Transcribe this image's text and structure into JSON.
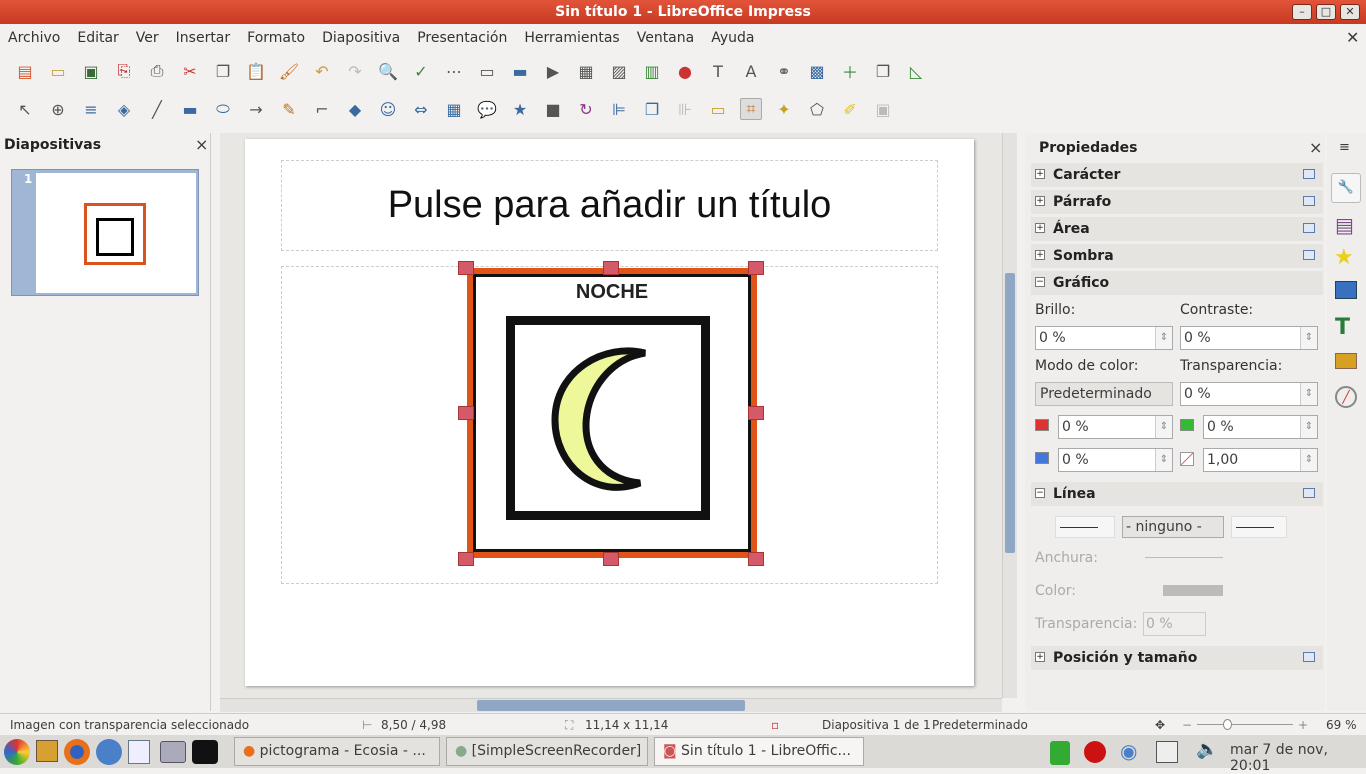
{
  "window": {
    "title": "Sin título 1 - LibreOffice Impress",
    "min": "–",
    "max": "□",
    "close": "✕"
  },
  "menu": [
    "Archivo",
    "Editar",
    "Ver",
    "Insertar",
    "Formato",
    "Diapositiva",
    "Presentación",
    "Herramientas",
    "Ventana",
    "Ayuda"
  ],
  "slides_pane": {
    "title": "Diapositivas",
    "close": "×",
    "slide_number": "1"
  },
  "slide": {
    "title_placeholder": "Pulse para añadir un título",
    "image_label": "NOCHE"
  },
  "sidebar": {
    "title": "Propiedades",
    "close": "×",
    "sections": {
      "caracter": "Carácter",
      "parrafo": "Párrafo",
      "area": "Área",
      "sombra": "Sombra",
      "grafico": "Gráfico",
      "linea": "Línea",
      "posicion": "Posición y tamaño"
    },
    "grafico": {
      "brillo_label": "Brillo:",
      "brillo": "0 %",
      "contraste_label": "Contraste:",
      "contraste": "0 %",
      "modo_label": "Modo de color:",
      "modo": "Predeterminado",
      "transp_label": "Transparencia:",
      "transp": "0 %",
      "red": "0 %",
      "green": "0 %",
      "blue": "0 %",
      "gamma": "1,00"
    },
    "linea": {
      "style": "- ninguno -",
      "anchura_label": "Anchura:",
      "color_label": "Color:",
      "transp_label": "Transparencia:",
      "transp": "0 %"
    }
  },
  "status": {
    "message": "Imagen con transparencia seleccionado",
    "position": "8,50 / 4,98",
    "size": "11,14 x 11,14",
    "slide": "Diapositiva 1 de 1",
    "master": "Predeterminado",
    "zoom": "69 %"
  },
  "taskbar": {
    "tasks": [
      "pictograma - Ecosia - ...",
      "[SimpleScreenRecorder]",
      "Sin título 1 - LibreOffic..."
    ],
    "clock": "mar 7 de nov, 20:01"
  }
}
